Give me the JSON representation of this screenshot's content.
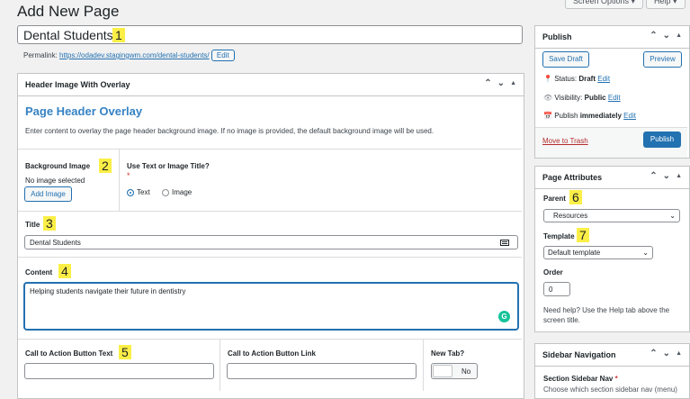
{
  "header": {
    "page_title": "Add New Page",
    "screen_options_label": "Screen Options ▾",
    "help_label": "Help ▾"
  },
  "post": {
    "title_value": "Dental Students",
    "permalink_label": "Permalink:",
    "permalink_url": "https://odadev.stagingwm.com/dental-students/",
    "edit_label": "Edit"
  },
  "markers": [
    "1",
    "2",
    "3",
    "4",
    "5",
    "6",
    "7"
  ],
  "overlay_box": {
    "heading": "Header Image With Overlay",
    "section_title": "Page Header Overlay",
    "description": "Enter content to overlay the page header background image. If no image is provided, the default background image will be used.",
    "background_image_label": "Background Image",
    "no_image_text": "No image selected",
    "add_image_label": "Add Image",
    "text_or_image_label": "Use Text or Image Title?",
    "required_mark": "*",
    "radio_text": "Text",
    "radio_image": "Image",
    "title_label": "Title",
    "title_value": "Dental Students",
    "content_label": "Content",
    "content_value": "Helping students navigate their future in dentistry",
    "cta_text_label": "Call to Action Button Text",
    "cta_link_label": "Call to Action Button Link",
    "new_tab_label": "New Tab?",
    "new_tab_value": "No"
  },
  "publish_box": {
    "heading": "Publish",
    "save_draft_label": "Save Draft",
    "preview_label": "Preview",
    "status_label": "Status:",
    "status_value": "Draft",
    "visibility_label": "Visibility:",
    "visibility_value": "Public",
    "publish_label": "Publish",
    "publish_value": "immediately",
    "edit_label": "Edit",
    "trash_label": "Move to Trash",
    "publish_button_label": "Publish"
  },
  "attributes_box": {
    "heading": "Page Attributes",
    "parent_label": "Parent",
    "parent_value": "Resources",
    "template_label": "Template",
    "template_value": "Default template",
    "order_label": "Order",
    "order_value": "0",
    "help_text": "Need help? Use the Help tab above the screen title."
  },
  "sidebar_nav_box": {
    "heading": "Sidebar Navigation",
    "section_label": "Section Sidebar Nav",
    "required_mark": "*",
    "hint": "Choose which section sidebar nav (menu)"
  },
  "colors": {
    "accent": "#2271b1",
    "marker": "#fbef47",
    "heading_blue": "#3582c4",
    "trash_red": "#b32d2e",
    "background": "#f1f1f1"
  }
}
